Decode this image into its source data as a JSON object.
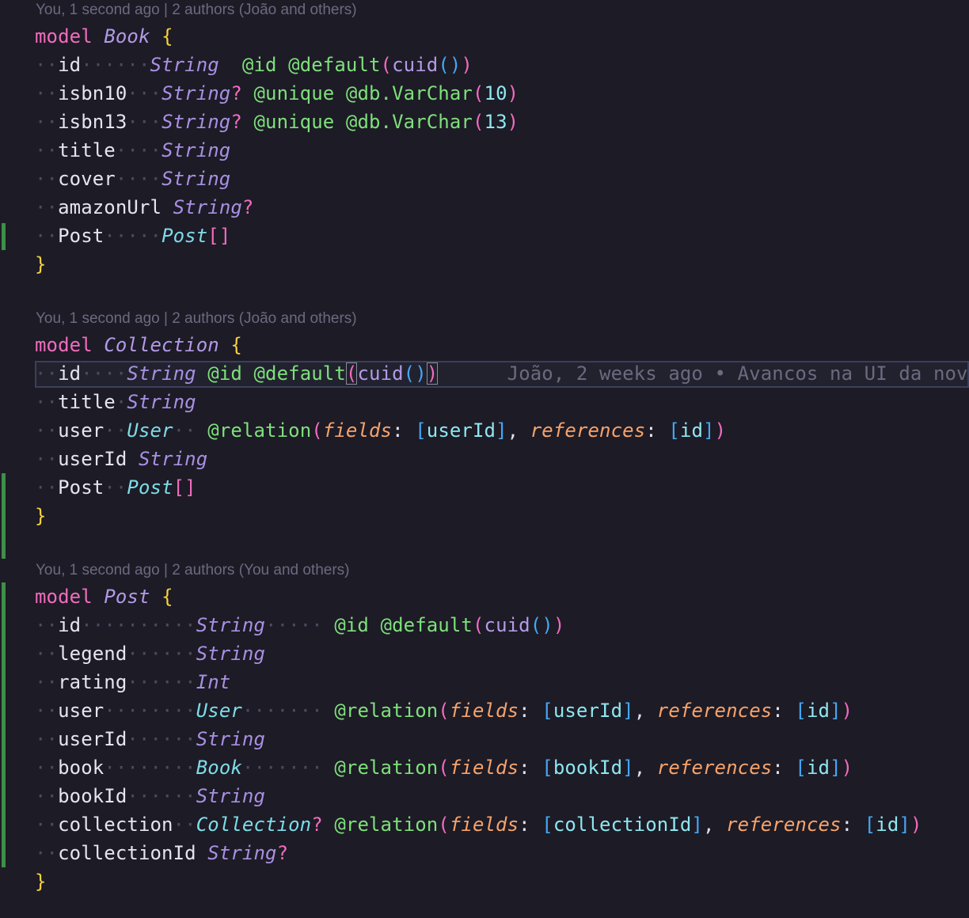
{
  "codelens": {
    "book": "You, 1 second ago | 2 authors (João and others)",
    "collection": "You, 1 second ago | 2 authors (João and others)",
    "post": "You, 1 second ago | 2 authors (You and others)"
  },
  "blame": "João, 2 weeks ago • Avancos na UI da nov",
  "colors": {
    "background": "#1d1b26",
    "keyword": "#f06cbd",
    "attribute": "#7ee07b",
    "type": "#a890e2",
    "relation_type": "#7ddce8",
    "argument": "#f7a36b",
    "bracket": "#43a7f5",
    "brace": "#f5d23f",
    "git_added": "#3e8f49"
  },
  "book": {
    "kw": "model",
    "name": "Book",
    "open": "{",
    "close": "}",
    "f_id": "id",
    "t_id": "String",
    "f_isbn10": "isbn10",
    "t_isbn10": "String",
    "f_isbn13": "isbn13",
    "t_isbn13": "String",
    "f_title": "title",
    "t_title": "String",
    "f_cover": "cover",
    "t_cover": "String",
    "f_amazon": "amazonUrl",
    "t_amazon": "String",
    "f_post": "Post",
    "t_post": "Post",
    "q": "?",
    "a_id": "@id",
    "a_default": "@default",
    "a_cuid": "cuid",
    "a_unique": "@unique",
    "a_varchar": "@db.VarChar",
    "n10": "10",
    "n13": "13",
    "lp": "(",
    "rp": ")",
    "arr": "[]"
  },
  "collection": {
    "kw": "model",
    "name": "Collection",
    "open": "{",
    "close": "}",
    "f_id": "id",
    "t_id": "String",
    "f_title": "title",
    "t_title": "String",
    "f_user": "user",
    "t_user": "User",
    "f_userId": "userId",
    "t_userId": "String",
    "f_post": "Post",
    "t_post": "Post",
    "a_id": "@id",
    "a_default": "@default",
    "a_cuid": "cuid",
    "a_relation": "@relation",
    "arg_fields": "fields",
    "arg_refs": "references",
    "v_userId": "userId",
    "v_id": "id"
  },
  "post": {
    "kw": "model",
    "name": "Post",
    "open": "{",
    "close": "}",
    "f_id": "id",
    "t_id": "String",
    "f_legend": "legend",
    "t_legend": "String",
    "f_rating": "rating",
    "t_rating": "Int",
    "f_user": "user",
    "t_user": "User",
    "f_userId": "userId",
    "t_userId": "String",
    "f_book": "book",
    "t_book": "Book",
    "f_bookId": "bookId",
    "t_bookId": "String",
    "f_collection": "collection",
    "t_collection": "Collection",
    "f_collectionId": "collectionId",
    "t_collectionId": "String",
    "a_id": "@id",
    "a_default": "@default",
    "a_cuid": "cuid",
    "a_relation": "@relation",
    "arg_fields": "fields",
    "arg_refs": "references",
    "v_userId": "userId",
    "v_bookId": "bookId",
    "v_collectionId": "collectionId",
    "v_id": "id"
  }
}
